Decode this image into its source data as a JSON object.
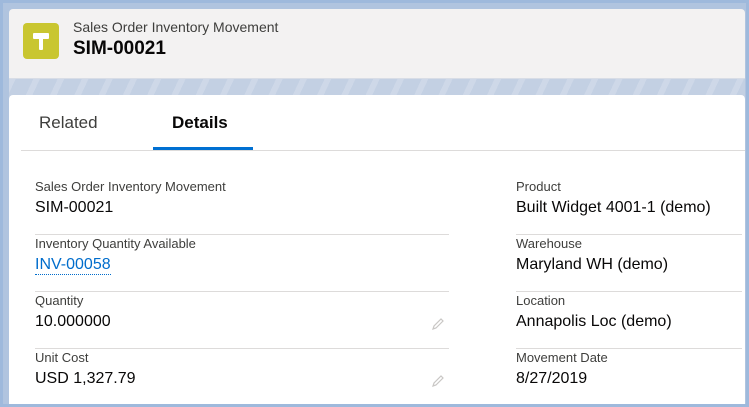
{
  "header": {
    "object_type": "Sales Order Inventory Movement",
    "record_name": "SIM-00021",
    "icon": "hammer-icon",
    "icon_color": "#c9c630"
  },
  "tabs": [
    {
      "label": "Related",
      "active": false
    },
    {
      "label": "Details",
      "active": true
    }
  ],
  "accent_color": "#0070d2",
  "fields_left": [
    {
      "label": "Sales Order Inventory Movement",
      "value": "SIM-00021"
    },
    {
      "label": "Inventory Quantity Available",
      "value": "INV-00058"
    },
    {
      "label": "Quantity",
      "value": "10.000000"
    },
    {
      "label": "Unit Cost",
      "value": "USD 1,327.79"
    }
  ],
  "fields_right": [
    {
      "label": "Product",
      "value": "Built Widget 4001-1 (demo)"
    },
    {
      "label": "Warehouse",
      "value": "Maryland WH (demo)"
    },
    {
      "label": "Location",
      "value": "Annapolis Loc (demo)"
    },
    {
      "label": "Movement Date",
      "value": "8/27/2019"
    }
  ]
}
